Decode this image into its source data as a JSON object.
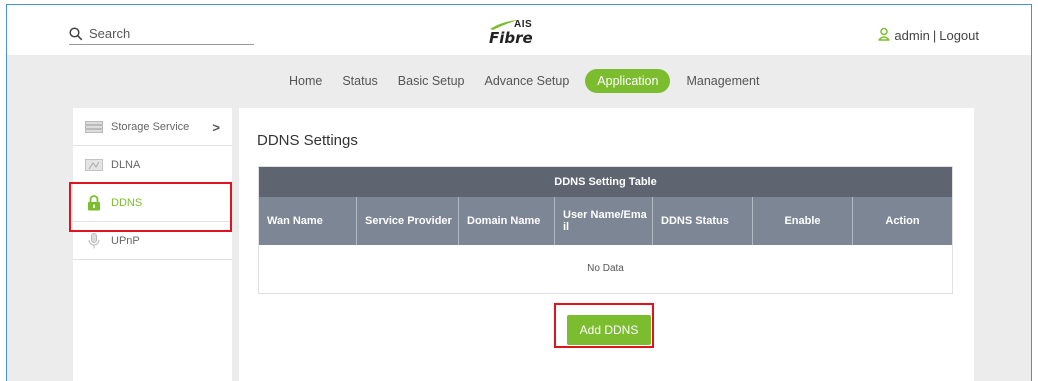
{
  "header": {
    "search_placeholder": "Search",
    "logo_top": "AIS",
    "logo_bottom": "Fibre",
    "user_name": "admin",
    "separator": "|",
    "logout_label": "Logout"
  },
  "nav": {
    "items": [
      "Home",
      "Status",
      "Basic Setup",
      "Advance Setup",
      "Application",
      "Management"
    ],
    "active": "Application"
  },
  "sidebar": {
    "items": [
      {
        "label": "Storage Service",
        "icon": "storage-icon"
      },
      {
        "label": "DLNA",
        "icon": "dlna-icon"
      },
      {
        "label": "DDNS",
        "icon": "lock-icon"
      },
      {
        "label": "UPnP",
        "icon": "microphone-icon"
      }
    ],
    "chevron": ">"
  },
  "main": {
    "title": "DDNS Settings",
    "table": {
      "caption": "DDNS Setting Table",
      "columns": [
        "Wan Name",
        "Service Provider",
        "Domain Name",
        "User Name/Email",
        "DDNS Status",
        "Enable",
        "Action"
      ],
      "empty_text": "No Data"
    },
    "add_button_label": "Add DDNS"
  },
  "colors": {
    "accent_green": "#7cbd2f",
    "table_caption": "#5e6470",
    "table_header": "#7d8694",
    "highlight_red": "#e0141e"
  }
}
